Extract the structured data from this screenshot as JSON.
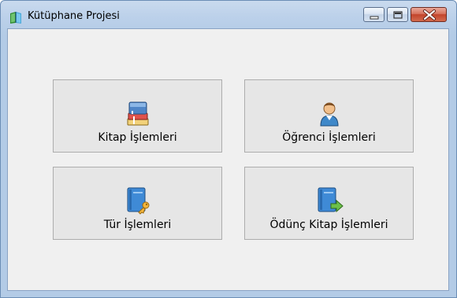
{
  "window": {
    "title": "Kütüphane Projesi",
    "icons": {
      "app": "book-icon",
      "minimize": "minimize-icon",
      "maximize": "maximize-icon",
      "close": "close-icon"
    }
  },
  "tiles": [
    {
      "label": "Kitap İşlemleri",
      "icon": "books-stack-icon"
    },
    {
      "label": "Öğrenci İşlemleri",
      "icon": "user-icon"
    },
    {
      "label": "Tür İşlemleri",
      "icon": "book-key-icon"
    },
    {
      "label": "Ödünç Kitap İşlemleri",
      "icon": "book-arrow-icon"
    }
  ],
  "colors": {
    "titlebar": "#bcd1ea",
    "client_background": "#f0f0f0",
    "tile_background": "#e6e6e6",
    "tile_border": "#adadad",
    "close_button": "#c2442b"
  }
}
